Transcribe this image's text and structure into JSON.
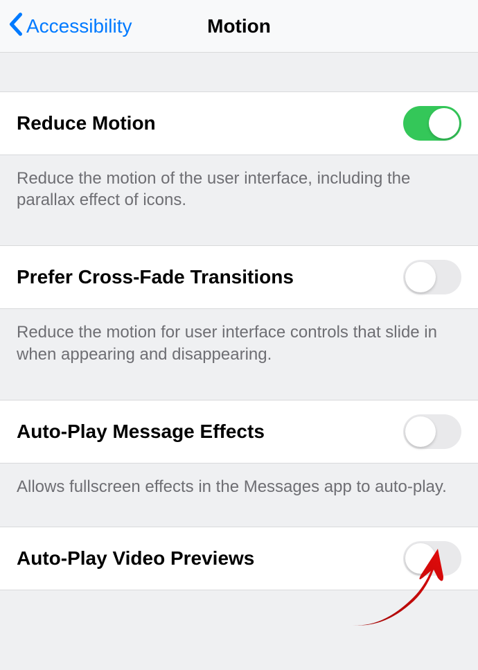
{
  "header": {
    "back_label": "Accessibility",
    "title": "Motion"
  },
  "settings": [
    {
      "label": "Reduce Motion",
      "enabled": true,
      "description": "Reduce the motion of the user interface, including the parallax effect of icons."
    },
    {
      "label": "Prefer Cross-Fade Transitions",
      "enabled": false,
      "description": "Reduce the motion for user interface controls that slide in when appearing and disappearing."
    },
    {
      "label": "Auto-Play Message Effects",
      "enabled": false,
      "description": "Allows fullscreen effects in the Messages app to auto-play."
    },
    {
      "label": "Auto-Play Video Previews",
      "enabled": false,
      "description": ""
    }
  ]
}
